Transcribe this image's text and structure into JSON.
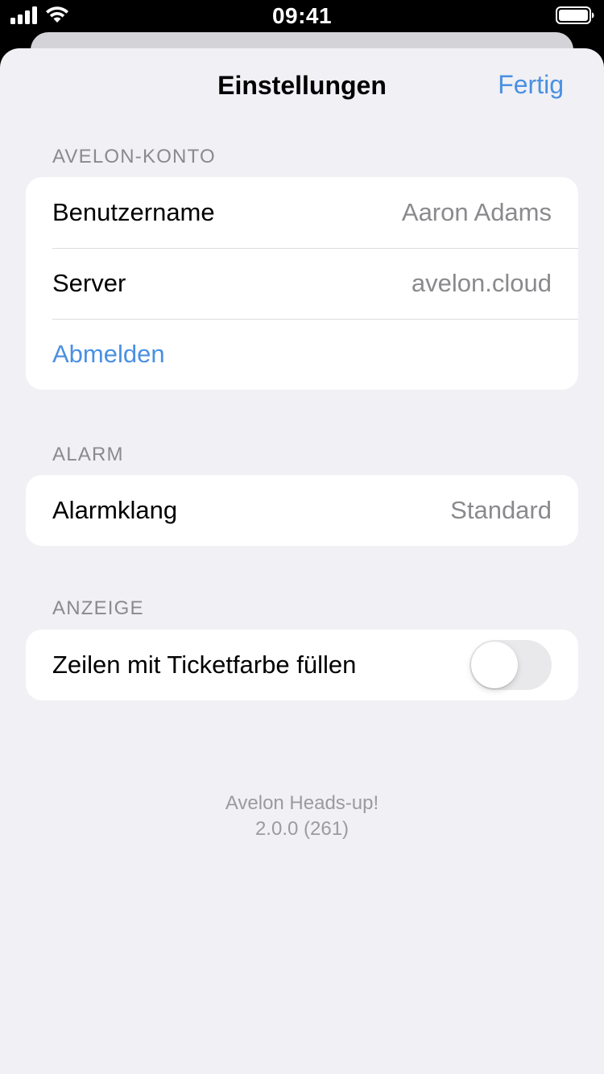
{
  "status_bar": {
    "time": "09:41",
    "icons": [
      "signal-icon",
      "wifi-icon",
      "battery-icon"
    ]
  },
  "nav": {
    "title": "Einstellungen",
    "done_label": "Fertig"
  },
  "colors": {
    "accent": "#4a90e2",
    "background": "#f0f0f5",
    "secondary_text": "#8a8a8e"
  },
  "sections": {
    "account": {
      "header": "AVELON-KONTO",
      "username_label": "Benutzername",
      "username_value": "Aaron Adams",
      "server_label": "Server",
      "server_value": "avelon.cloud",
      "logout_label": "Abmelden"
    },
    "alarm": {
      "header": "ALARM",
      "sound_label": "Alarmklang",
      "sound_value": "Standard"
    },
    "display": {
      "header": "ANZEIGE",
      "fill_rows_label": "Zeilen mit Ticketfarbe füllen",
      "fill_rows_enabled": false
    }
  },
  "footer": {
    "app_name": "Avelon Heads-up!",
    "version": "2.0.0 (261)"
  }
}
